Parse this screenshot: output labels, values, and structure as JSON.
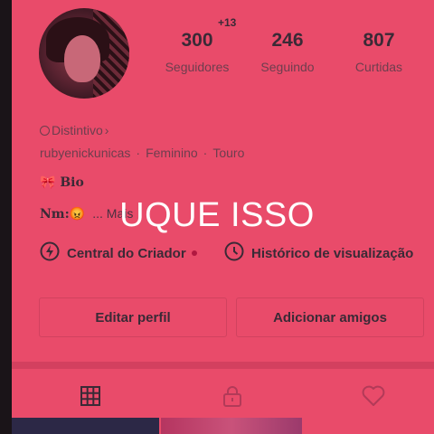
{
  "profile": {
    "stats": [
      {
        "value": "300",
        "label": "Seguidores"
      },
      {
        "value": "246",
        "label": "Seguindo"
      },
      {
        "value": "807",
        "label": "Curtidas"
      }
    ],
    "followers_delta": "+13",
    "badge_label": "Distintivo",
    "username": "rubyenickunicas",
    "gender": "Feminino",
    "sign": "Touro",
    "bio_label": "Bio",
    "bio_text": "Nm:",
    "bio_more": "... Mais",
    "overlay_text": "UQUE ISSO"
  },
  "links": {
    "creator_center": "Central do Criador",
    "view_history": "Histórico de visualização"
  },
  "buttons": {
    "edit_profile": "Editar perfil",
    "add_friends": "Adicionar amigos"
  },
  "tabs": [
    {
      "icon": "grid-icon"
    },
    {
      "icon": "lock-icon"
    },
    {
      "icon": "heart-icon"
    }
  ]
}
